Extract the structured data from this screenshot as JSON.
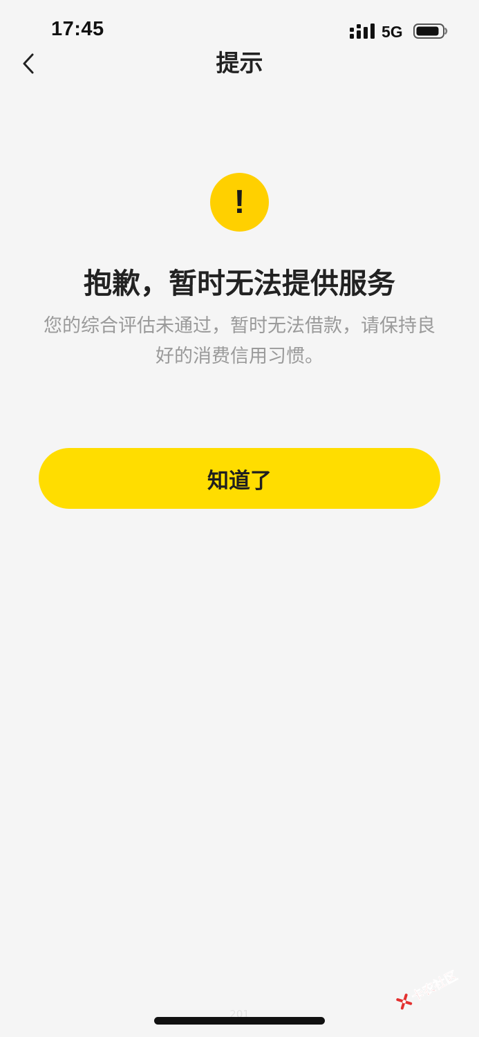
{
  "status_bar": {
    "time": "17:45",
    "network": "5G",
    "signal_icon": "signal-bars-icon",
    "battery_icon": "battery-icon"
  },
  "nav": {
    "title": "提示",
    "back_icon": "chevron-left-icon"
  },
  "result": {
    "icon": "exclamation-icon",
    "icon_symbol": "!",
    "title": "抱歉，暂时无法提供服务",
    "description": "您的综合评估未通过，暂时无法借款，请保持良好的消费信用习惯。"
  },
  "actions": {
    "confirm_label": "知道了"
  },
  "footer": {
    "page_number": "201"
  },
  "watermark": {
    "text": "卡农社区"
  },
  "colors": {
    "accent": "#ffdd00",
    "icon_bg": "#ffd000",
    "background": "#f5f5f5",
    "muted_text": "#9a9a9a",
    "watermark": "#e3302f"
  }
}
